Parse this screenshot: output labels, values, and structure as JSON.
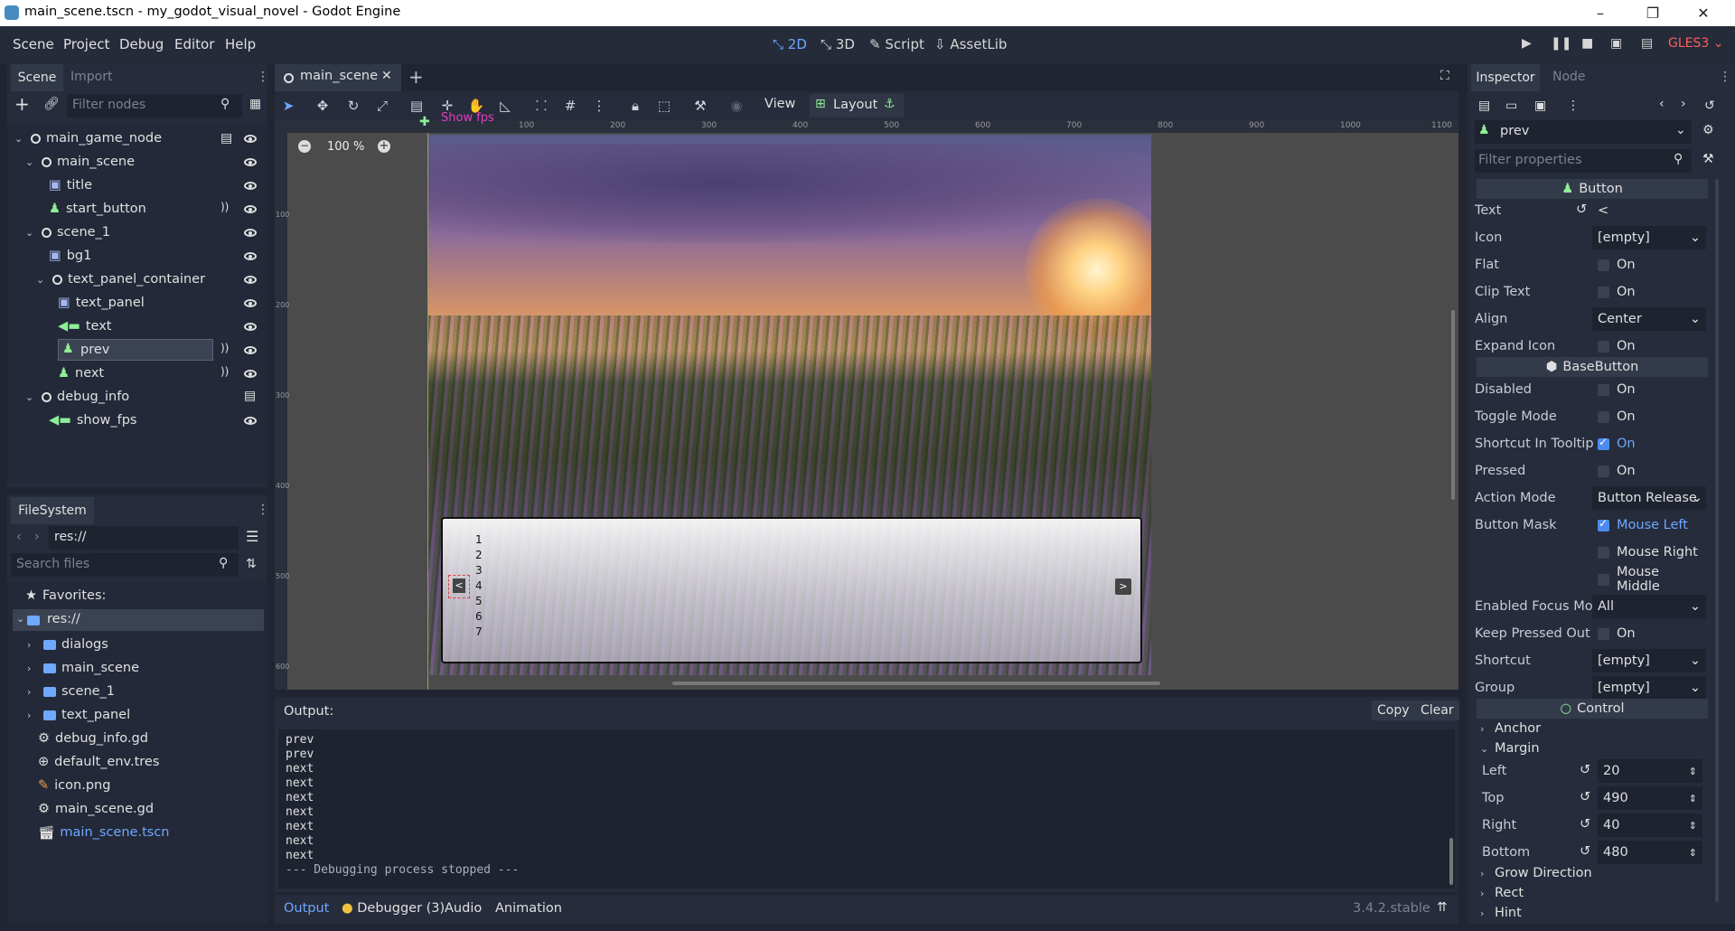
{
  "window": {
    "title": "main_scene.tscn - my_godot_visual_novel - Godot Engine",
    "controls": [
      "–",
      "❐",
      "✕"
    ]
  },
  "menu": {
    "items": [
      "Scene",
      "Project",
      "Debug",
      "Editor",
      "Help"
    ],
    "workspaces": [
      "2D",
      "3D",
      "Script",
      "AssetLib"
    ],
    "renderer": "GLES3"
  },
  "scene_dock": {
    "tabs": [
      "Scene",
      "Import"
    ],
    "filter_placeholder": "Filter nodes",
    "nodes": [
      {
        "name": "main_game_node",
        "depth": 0,
        "kind": "node2d",
        "script": true
      },
      {
        "name": "main_scene",
        "depth": 1,
        "kind": "node2d"
      },
      {
        "name": "title",
        "depth": 2,
        "kind": "sprite"
      },
      {
        "name": "start_button",
        "depth": 2,
        "kind": "button",
        "signal": true
      },
      {
        "name": "scene_1",
        "depth": 1,
        "kind": "node2d"
      },
      {
        "name": "bg1",
        "depth": 2,
        "kind": "sprite"
      },
      {
        "name": "text_panel_container",
        "depth": 2,
        "kind": "node2d"
      },
      {
        "name": "text_panel",
        "depth": 3,
        "kind": "sprite"
      },
      {
        "name": "text",
        "depth": 3,
        "kind": "label"
      },
      {
        "name": "prev",
        "depth": 3,
        "kind": "button",
        "signal": true,
        "selected": true
      },
      {
        "name": "next",
        "depth": 3,
        "kind": "button",
        "signal": true
      },
      {
        "name": "debug_info",
        "depth": 1,
        "kind": "node2d",
        "script": true
      },
      {
        "name": "show_fps",
        "depth": 2,
        "kind": "label"
      }
    ]
  },
  "filesystem": {
    "tab": "FileSystem",
    "path": "res://",
    "search_placeholder": "Search files",
    "favorites_label": "Favorites:",
    "root": "res://",
    "entries": [
      {
        "name": "dialogs",
        "type": "folder"
      },
      {
        "name": "main_scene",
        "type": "folder"
      },
      {
        "name": "scene_1",
        "type": "folder"
      },
      {
        "name": "text_panel",
        "type": "folder"
      },
      {
        "name": "debug_info.gd",
        "type": "script"
      },
      {
        "name": "default_env.tres",
        "type": "resource"
      },
      {
        "name": "icon.png",
        "type": "image"
      },
      {
        "name": "main_scene.gd",
        "type": "script"
      },
      {
        "name": "main_scene.tscn",
        "type": "scene",
        "highlighted": true
      }
    ]
  },
  "editor": {
    "scene_tab": "main_scene",
    "toolbar": {
      "view": "View",
      "layout": "Layout"
    },
    "zoom": "100 %",
    "ruler_marks": [
      "100",
      "200",
      "300",
      "400",
      "500",
      "600",
      "700",
      "800",
      "900",
      "1000",
      "1100"
    ],
    "ruler_left_marks": [
      "100",
      "200",
      "300",
      "400",
      "500",
      "600"
    ],
    "show_fps_label": "Show fps",
    "panel_lines": [
      "1",
      "2",
      "3",
      "4",
      "5",
      "6",
      "7"
    ],
    "prev_button": "<",
    "next_button": ">"
  },
  "output": {
    "title": "Output:",
    "copy": "Copy",
    "clear": "Clear",
    "lines": [
      "prev",
      "prev",
      "next",
      "next",
      "next",
      "next",
      "next",
      "next",
      "next",
      "--- Debugging process stopped ---"
    ],
    "bottom_tabs": [
      "Output",
      "Debugger (3)",
      "Audio",
      "Animation"
    ],
    "version": "3.4.2.stable"
  },
  "inspector": {
    "tabs": [
      "Inspector",
      "Node"
    ],
    "object": "prev",
    "filter_placeholder": "Filter properties",
    "sections": {
      "button": "Button",
      "basebutton": "BaseButton",
      "control": "Control"
    },
    "button_props": [
      {
        "label": "Text",
        "value": "<",
        "type": "text"
      },
      {
        "label": "Icon",
        "value": "[empty]",
        "type": "dropdown"
      },
      {
        "label": "Flat",
        "value": "On",
        "type": "check",
        "checked": false
      },
      {
        "label": "Clip Text",
        "value": "On",
        "type": "check",
        "checked": false
      },
      {
        "label": "Align",
        "value": "Center",
        "type": "dropdown"
      },
      {
        "label": "Expand Icon",
        "value": "On",
        "type": "check",
        "checked": false
      }
    ],
    "basebutton_props": [
      {
        "label": "Disabled",
        "value": "On",
        "type": "check",
        "checked": false
      },
      {
        "label": "Toggle Mode",
        "value": "On",
        "type": "check",
        "checked": false
      },
      {
        "label": "Shortcut In Tooltip",
        "value": "On",
        "type": "check",
        "checked": true
      },
      {
        "label": "Pressed",
        "value": "On",
        "type": "check",
        "checked": false
      },
      {
        "label": "Action Mode",
        "value": "Button Release",
        "type": "dropdown"
      },
      {
        "label": "Button Mask",
        "value": "Mouse Left",
        "type": "check",
        "checked": true
      },
      {
        "label": "",
        "value": "Mouse Right",
        "type": "check",
        "checked": false
      },
      {
        "label": "",
        "value": "Mouse Middle",
        "type": "check",
        "checked": false
      },
      {
        "label": "Enabled Focus Mo",
        "value": "All",
        "type": "dropdown"
      },
      {
        "label": "Keep Pressed Out",
        "value": "On",
        "type": "check",
        "checked": false
      },
      {
        "label": "Shortcut",
        "value": "[empty]",
        "type": "dropdown"
      },
      {
        "label": "Group",
        "value": "[empty]",
        "type": "dropdown"
      }
    ],
    "control_groups": [
      "Anchor",
      "Margin"
    ],
    "margin": [
      {
        "label": "Left",
        "value": "20"
      },
      {
        "label": "Top",
        "value": "490"
      },
      {
        "label": "Right",
        "value": "40"
      },
      {
        "label": "Bottom",
        "value": "480"
      }
    ],
    "more_groups": [
      "Grow Direction",
      "Rect",
      "Hint"
    ]
  },
  "colors": {
    "accent": "#6ea8ff",
    "background": "#202531",
    "panel": "#262c3b",
    "renderer": "#ff5d5d",
    "fps_label": "#e040c0"
  }
}
